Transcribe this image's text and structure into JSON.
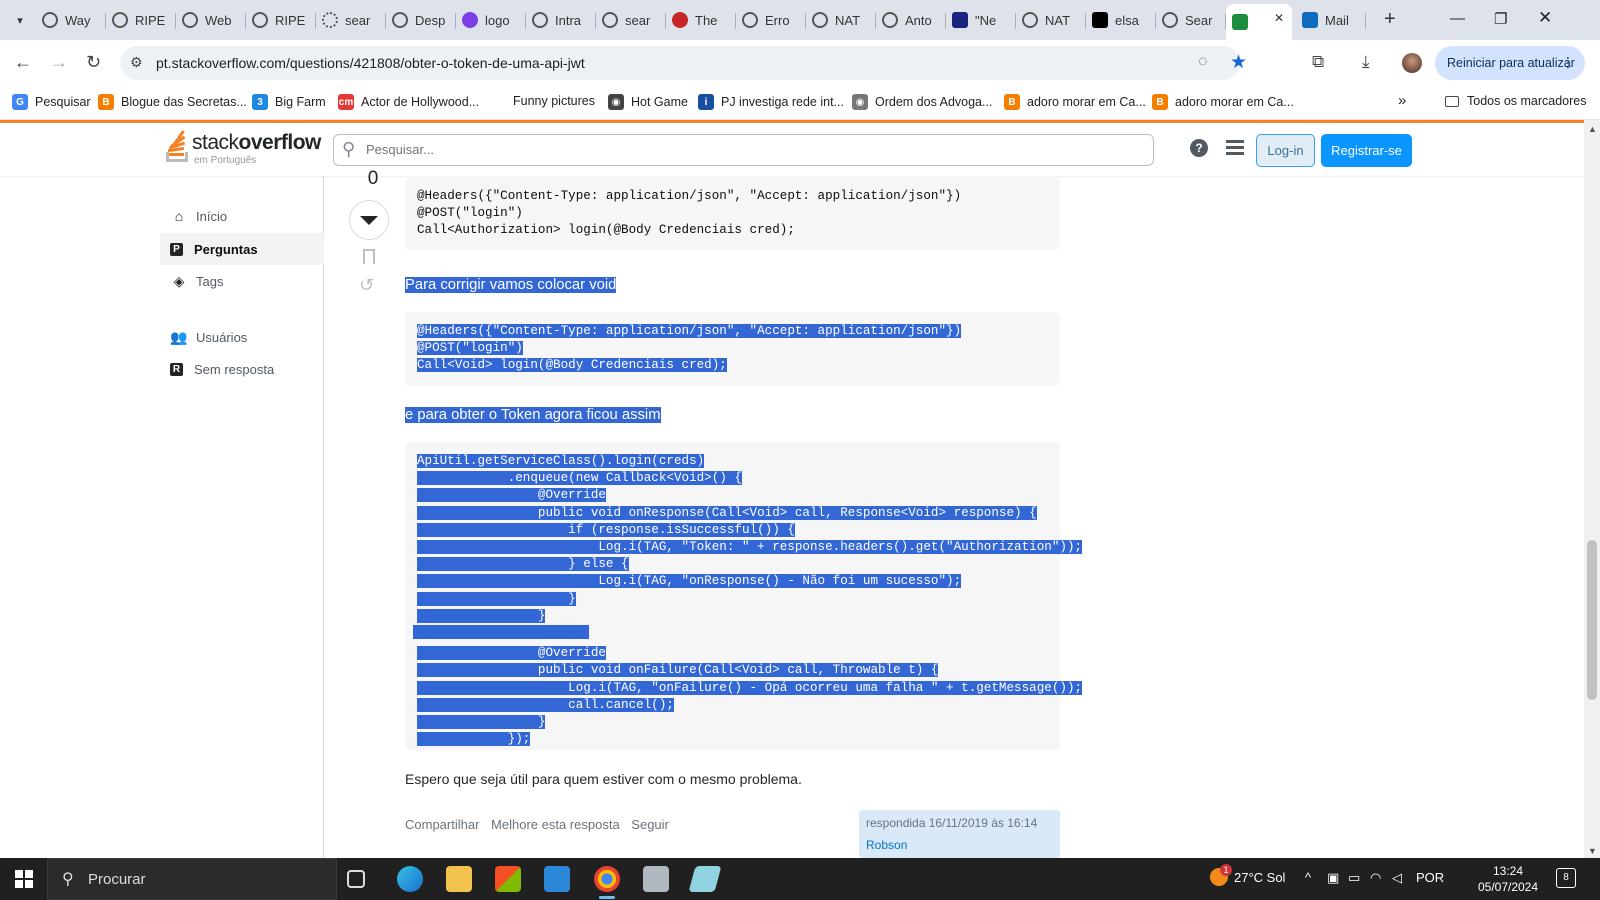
{
  "browser": {
    "tabs": [
      {
        "title": "Way",
        "icon": "globe"
      },
      {
        "title": "RIPE",
        "icon": "globe"
      },
      {
        "title": "Web",
        "icon": "globe"
      },
      {
        "title": "RIPE",
        "icon": "globe"
      },
      {
        "title": "sear",
        "icon": "loading"
      },
      {
        "title": "Desp",
        "icon": "globe"
      },
      {
        "title": "logo",
        "icon": "purple-circle"
      },
      {
        "title": "Intra",
        "icon": "globe"
      },
      {
        "title": "sear",
        "icon": "globe"
      },
      {
        "title": "The",
        "icon": "red-circle"
      },
      {
        "title": "Erro",
        "icon": "globe"
      },
      {
        "title": "NAT",
        "icon": "globe"
      },
      {
        "title": "Anto",
        "icon": "globe"
      },
      {
        "title": "\"Ne",
        "icon": "e-logo"
      },
      {
        "title": "NAT",
        "icon": "globe"
      },
      {
        "title": "elsa",
        "icon": "x-logo"
      },
      {
        "title": "Sear",
        "icon": "globe"
      },
      {
        "title": "",
        "icon": "stackoverflow",
        "active": true
      },
      {
        "title": "Mail",
        "icon": "outlook"
      }
    ],
    "url": "pt.stackoverflow.com/questions/421808/obter-o-token-de-uma-api-jwt",
    "restart_label": "Reiniciar para atualizar",
    "bookmarks": [
      {
        "label": "Pesquisar",
        "icon": "G",
        "color": "#4285f4"
      },
      {
        "label": "Blogue das Secretas...",
        "icon": "B",
        "color": "#f57d00"
      },
      {
        "label": "Big Farm",
        "icon": "3",
        "color": "#1e88e5"
      },
      {
        "label": "Actor de Hollywood...",
        "icon": "cm",
        "color": "#e53935"
      },
      {
        "label": "Funny pictures",
        "icon": "",
        "color": "#ffffff"
      },
      {
        "label": "Hot Game",
        "icon": "◉",
        "color": "#444444"
      },
      {
        "label": "PJ investiga rede int...",
        "icon": "i",
        "color": "#1a4fa0"
      },
      {
        "label": "Ordem dos Advoga...",
        "icon": "◉",
        "color": "#777777"
      },
      {
        "label": "adoro morar em Ca...",
        "icon": "B",
        "color": "#f57d00"
      },
      {
        "label": "adoro morar em Ca...",
        "icon": "B",
        "color": "#f57d00"
      }
    ],
    "more_bookmarks": "»",
    "all_bookmarks": "Todos os marcadores"
  },
  "site": {
    "logo_word_light": "stack",
    "logo_word_bold": "overflow",
    "logo_sub": "em Português",
    "search_placeholder": "Pesquisar...",
    "login_label": "Log-in",
    "signup_label": "Registrar-se",
    "nav": [
      {
        "label": "Início",
        "icon": "home"
      },
      {
        "label": "Perguntas",
        "icon": "questions",
        "selected": true
      },
      {
        "label": "Tags",
        "icon": "tag"
      },
      {
        "label": "Usuários",
        "icon": "users"
      },
      {
        "label": "Sem resposta",
        "icon": "unanswered"
      }
    ]
  },
  "post": {
    "vote_count": "0",
    "code1": [
      "@Headers({\"Content-Type: application/json\", \"Accept: application/json\"})",
      "@POST(\"login\")",
      "Call<Authorization> login(@Body Credenciais cred);"
    ],
    "paragraph1": "Para corrigir vamos colocar void",
    "code2": [
      "@Headers({\"Content-Type: application/json\", \"Accept: application/json\"})",
      "@POST(\"login\")",
      "Call<Void> login(@Body Credenciais cred);"
    ],
    "paragraph2": "e para obter o Token agora ficou assim",
    "code3": [
      "ApiUtil.getServiceClass().login(creds)",
      "            .enqueue(new Callback<Void>() {",
      "                @Override",
      "                public void onResponse(Call<Void> call, Response<Void> response) {",
      "                    if (response.isSuccessful()) {",
      "                        Log.i(TAG, \"Token: \" + response.headers().get(\"Authorization\"));",
      "                    } else {",
      "                        Log.i(TAG, \"onResponse() - Não foi um sucesso\");",
      "                    }",
      "                }",
      "",
      "                @Override",
      "                public void onFailure(Call<Void> call, Throwable t) {",
      "                    Log.i(TAG, \"onFailure() - Opá ocorreu uma falha \" + t.getMessage());",
      "                    call.cancel();",
      "                }",
      "            });"
    ],
    "paragraph3": "Espero que seja útil para quem estiver com o mesmo problema.",
    "menu": [
      "Compartilhar",
      "Melhore esta resposta",
      "Seguir"
    ],
    "answered": "respondida 16/11/2019 às 16:14",
    "author": "Robson"
  },
  "taskbar": {
    "search_label": "Procurar",
    "weather": "27°C  Sol",
    "weather_badge": "1",
    "language": "POR",
    "time": "13:24",
    "date": "05/07/2024",
    "notifications": "8"
  },
  "colors": {
    "so_orange": "#f48225",
    "so_blue": "#0a95ff",
    "selection": "#3367d6"
  }
}
